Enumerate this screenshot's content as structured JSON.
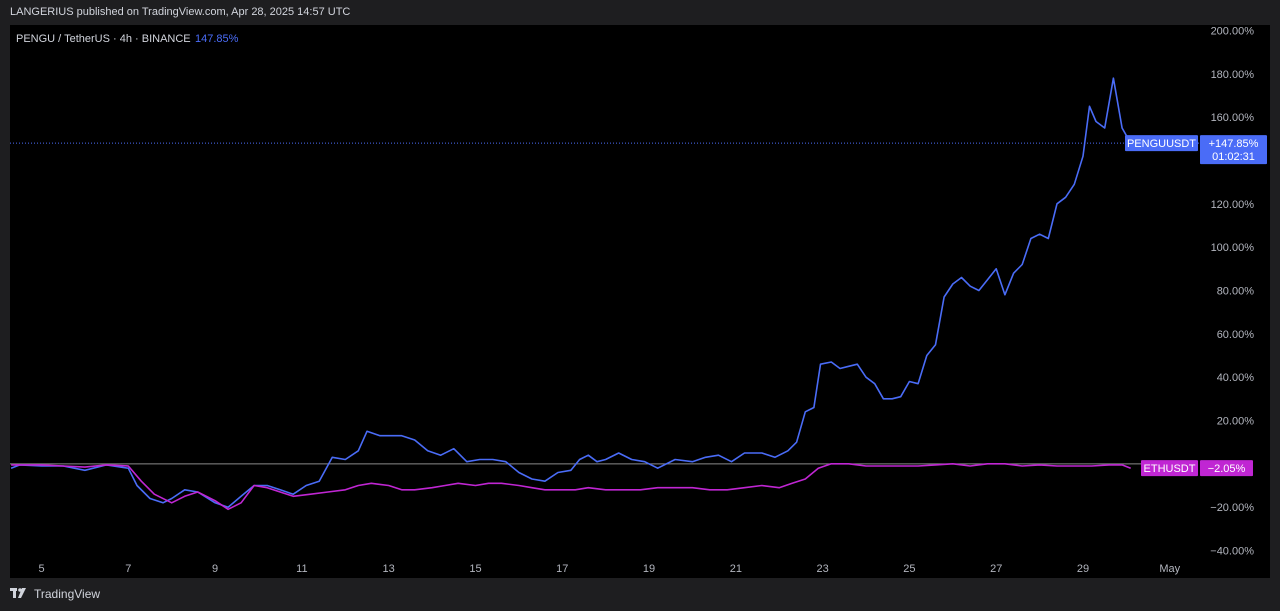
{
  "header": {
    "published_text": "LANGERIUS published on TradingView.com, Apr 28, 2025 14:57 UTC"
  },
  "footer": {
    "brand": "TradingView",
    "logo_icon": "tradingview-logo-icon"
  },
  "colors": {
    "background": "#000000",
    "frame": "#1e1e20",
    "pengu": "#4a6cf7",
    "eth": "#c026d3",
    "axis_text": "#b2b5be",
    "zero_line": "#888888"
  },
  "chart_data": {
    "type": "line",
    "symbol_info": "PENGU / TetherUS · 4h · BINANCE",
    "symbol_change": "147.85%",
    "x_ticks": [
      {
        "day": 5,
        "label": "5"
      },
      {
        "day": 7,
        "label": "7"
      },
      {
        "day": 9,
        "label": "9"
      },
      {
        "day": 11,
        "label": "11"
      },
      {
        "day": 13,
        "label": "13"
      },
      {
        "day": 15,
        "label": "15"
      },
      {
        "day": 17,
        "label": "17"
      },
      {
        "day": 19,
        "label": "19"
      },
      {
        "day": 21,
        "label": "21"
      },
      {
        "day": 23,
        "label": "23"
      },
      {
        "day": 25,
        "label": "25"
      },
      {
        "day": 27,
        "label": "27"
      },
      {
        "day": 29,
        "label": "29"
      },
      {
        "day": 31,
        "label": "May"
      }
    ],
    "xlim": [
      4.25,
      32.85
    ],
    "y_ticks": [
      {
        "value": 200,
        "label": "200.00%"
      },
      {
        "value": 180,
        "label": "180.00%"
      },
      {
        "value": 160,
        "label": "160.00%"
      },
      {
        "value": 120,
        "label": "120.00%"
      },
      {
        "value": 100,
        "label": "100.00%"
      },
      {
        "value": 80,
        "label": "80.00%"
      },
      {
        "value": 60,
        "label": "60.00%"
      },
      {
        "value": 40,
        "label": "40.00%"
      },
      {
        "value": 20,
        "label": "20.00%"
      },
      {
        "value": -20,
        "label": "−20.00%"
      },
      {
        "value": -40,
        "label": "−40.00%"
      }
    ],
    "ylim": [
      -44,
      202
    ],
    "series": [
      {
        "name": "PENGUUSDT",
        "color": "#4a6cf7",
        "last_label": "+147.85%",
        "countdown": "01:02:31",
        "points": [
          [
            4.3,
            -2
          ],
          [
            4.5,
            -0.5
          ],
          [
            5,
            -1
          ],
          [
            5.5,
            -1
          ],
          [
            6,
            -3
          ],
          [
            6.5,
            -0.5
          ],
          [
            7,
            -2
          ],
          [
            7.2,
            -10
          ],
          [
            7.5,
            -16
          ],
          [
            7.8,
            -18
          ],
          [
            8,
            -16
          ],
          [
            8.3,
            -12
          ],
          [
            8.6,
            -13
          ],
          [
            9,
            -18
          ],
          [
            9.3,
            -20
          ],
          [
            9.6,
            -15
          ],
          [
            9.9,
            -10
          ],
          [
            10.2,
            -10
          ],
          [
            10.5,
            -12
          ],
          [
            10.8,
            -14
          ],
          [
            11.1,
            -10
          ],
          [
            11.4,
            -8
          ],
          [
            11.7,
            3
          ],
          [
            12,
            2
          ],
          [
            12.3,
            6
          ],
          [
            12.5,
            15
          ],
          [
            12.8,
            13
          ],
          [
            13,
            13
          ],
          [
            13.3,
            13
          ],
          [
            13.6,
            11
          ],
          [
            13.9,
            6
          ],
          [
            14.2,
            4
          ],
          [
            14.5,
            7
          ],
          [
            14.8,
            1
          ],
          [
            15.1,
            2
          ],
          [
            15.4,
            2
          ],
          [
            15.7,
            1
          ],
          [
            16,
            -4
          ],
          [
            16.3,
            -7
          ],
          [
            16.6,
            -8
          ],
          [
            16.9,
            -4
          ],
          [
            17.2,
            -3
          ],
          [
            17.4,
            2
          ],
          [
            17.6,
            4
          ],
          [
            17.8,
            1
          ],
          [
            18,
            2
          ],
          [
            18.3,
            5
          ],
          [
            18.6,
            2
          ],
          [
            18.9,
            1
          ],
          [
            19.2,
            -2
          ],
          [
            19.6,
            2
          ],
          [
            20,
            1
          ],
          [
            20.3,
            3
          ],
          [
            20.6,
            4
          ],
          [
            20.9,
            1
          ],
          [
            21.2,
            5
          ],
          [
            21.6,
            5
          ],
          [
            21.9,
            3
          ],
          [
            22.2,
            6
          ],
          [
            22.4,
            10
          ],
          [
            22.6,
            24
          ],
          [
            22.8,
            26
          ],
          [
            22.95,
            46
          ],
          [
            23.2,
            47
          ],
          [
            23.4,
            44
          ],
          [
            23.6,
            45
          ],
          [
            23.8,
            46
          ],
          [
            24,
            40
          ],
          [
            24.2,
            37
          ],
          [
            24.4,
            30
          ],
          [
            24.6,
            30
          ],
          [
            24.8,
            31
          ],
          [
            25,
            38
          ],
          [
            25.2,
            37
          ],
          [
            25.4,
            50
          ],
          [
            25.6,
            55
          ],
          [
            25.8,
            77
          ],
          [
            26,
            83
          ],
          [
            26.2,
            86
          ],
          [
            26.4,
            82
          ],
          [
            26.6,
            80
          ],
          [
            26.8,
            85
          ],
          [
            27,
            90
          ],
          [
            27.2,
            78
          ],
          [
            27.4,
            88
          ],
          [
            27.6,
            92
          ],
          [
            27.8,
            104
          ],
          [
            28,
            106
          ],
          [
            28.2,
            104
          ],
          [
            28.4,
            120
          ],
          [
            28.6,
            123
          ],
          [
            28.8,
            129
          ],
          [
            29,
            142
          ],
          [
            29.15,
            165
          ],
          [
            29.3,
            158
          ],
          [
            29.5,
            155
          ],
          [
            29.7,
            178
          ],
          [
            29.9,
            155
          ],
          [
            30.1,
            148
          ]
        ]
      },
      {
        "name": "ETHUSDT",
        "color": "#c026d3",
        "last_label": "−2.05%",
        "points": [
          [
            4.3,
            -0.5
          ],
          [
            5,
            -0.5
          ],
          [
            5.5,
            -1
          ],
          [
            6,
            -1.5
          ],
          [
            6.5,
            -0.5
          ],
          [
            7,
            -1
          ],
          [
            7.3,
            -8
          ],
          [
            7.6,
            -14
          ],
          [
            8,
            -18
          ],
          [
            8.3,
            -15
          ],
          [
            8.6,
            -13
          ],
          [
            9,
            -17
          ],
          [
            9.3,
            -21
          ],
          [
            9.6,
            -18
          ],
          [
            9.9,
            -10
          ],
          [
            10.2,
            -11
          ],
          [
            10.5,
            -13
          ],
          [
            10.8,
            -15
          ],
          [
            11.2,
            -14
          ],
          [
            11.6,
            -13
          ],
          [
            12,
            -12
          ],
          [
            12.3,
            -10
          ],
          [
            12.6,
            -9
          ],
          [
            13,
            -10
          ],
          [
            13.3,
            -12
          ],
          [
            13.6,
            -12
          ],
          [
            14,
            -11
          ],
          [
            14.3,
            -10
          ],
          [
            14.6,
            -9
          ],
          [
            15,
            -10
          ],
          [
            15.3,
            -9
          ],
          [
            15.6,
            -9
          ],
          [
            16,
            -10
          ],
          [
            16.3,
            -11
          ],
          [
            16.6,
            -12
          ],
          [
            17,
            -12
          ],
          [
            17.3,
            -12
          ],
          [
            17.6,
            -11
          ],
          [
            18,
            -12
          ],
          [
            18.4,
            -12
          ],
          [
            18.8,
            -12
          ],
          [
            19.2,
            -11
          ],
          [
            19.6,
            -11
          ],
          [
            20,
            -11
          ],
          [
            20.4,
            -12
          ],
          [
            20.8,
            -12
          ],
          [
            21.2,
            -11
          ],
          [
            21.6,
            -10
          ],
          [
            22,
            -11
          ],
          [
            22.3,
            -9
          ],
          [
            22.6,
            -7
          ],
          [
            22.9,
            -2
          ],
          [
            23.2,
            0
          ],
          [
            23.6,
            0
          ],
          [
            24,
            -1
          ],
          [
            24.4,
            -1
          ],
          [
            24.8,
            -1
          ],
          [
            25.2,
            -1
          ],
          [
            25.6,
            -0.5
          ],
          [
            26,
            0
          ],
          [
            26.4,
            -1
          ],
          [
            26.8,
            0
          ],
          [
            27.2,
            0
          ],
          [
            27.6,
            -1
          ],
          [
            28,
            -0.5
          ],
          [
            28.4,
            -1
          ],
          [
            28.8,
            -1
          ],
          [
            29.2,
            -1
          ],
          [
            29.6,
            -0.5
          ],
          [
            29.9,
            -0.5
          ],
          [
            30.1,
            -2
          ]
        ]
      }
    ]
  }
}
